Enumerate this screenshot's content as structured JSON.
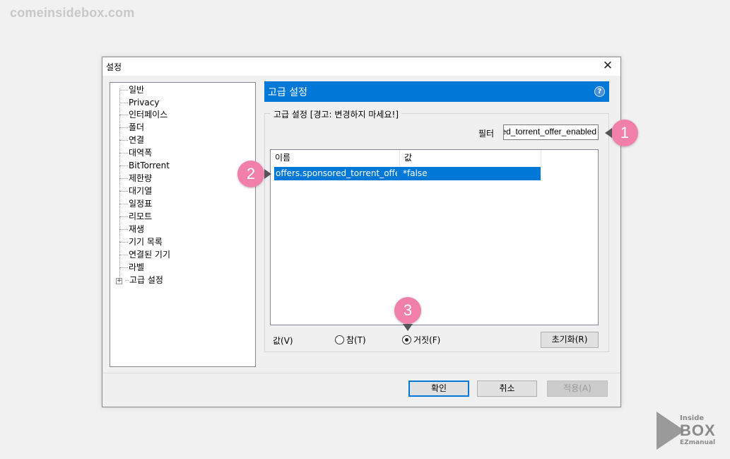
{
  "watermark": "comeinsidebox.com",
  "dialog": {
    "title": "설정",
    "tree_items": [
      "일반",
      "Privacy",
      "인터페이스",
      "폴더",
      "연결",
      "대역폭",
      "BitTorrent",
      "제한량",
      "대기열",
      "일정표",
      "리모트",
      "재생",
      "기기 목록",
      "연결된 기기",
      "라벨",
      "고급 설정"
    ],
    "panel_title": "고급 설정",
    "group_label": "고급 설정 [경고: 변경하지 마세요!]",
    "filter_label": "필터",
    "filter_value": "offers.sponsored_torrent_offer_enabled",
    "columns": {
      "name": "이름",
      "value": "값"
    },
    "rows": [
      {
        "name": "offers.sponsored_torrent_offer...",
        "value": "*false"
      }
    ],
    "value_label": "값(V)",
    "radio_true": "참(T)",
    "radio_false": "거짓(F)",
    "reset_button": "초기화(R)",
    "ok_button": "확인",
    "cancel_button": "취소",
    "apply_button": "적용(A)"
  },
  "badges": [
    "1",
    "2",
    "3"
  ],
  "logo": {
    "line1": "Inside",
    "line2": "BOX",
    "line3": "EZmanual"
  },
  "colors": {
    "accent": "#0078d7",
    "badge": "#f07faa"
  }
}
